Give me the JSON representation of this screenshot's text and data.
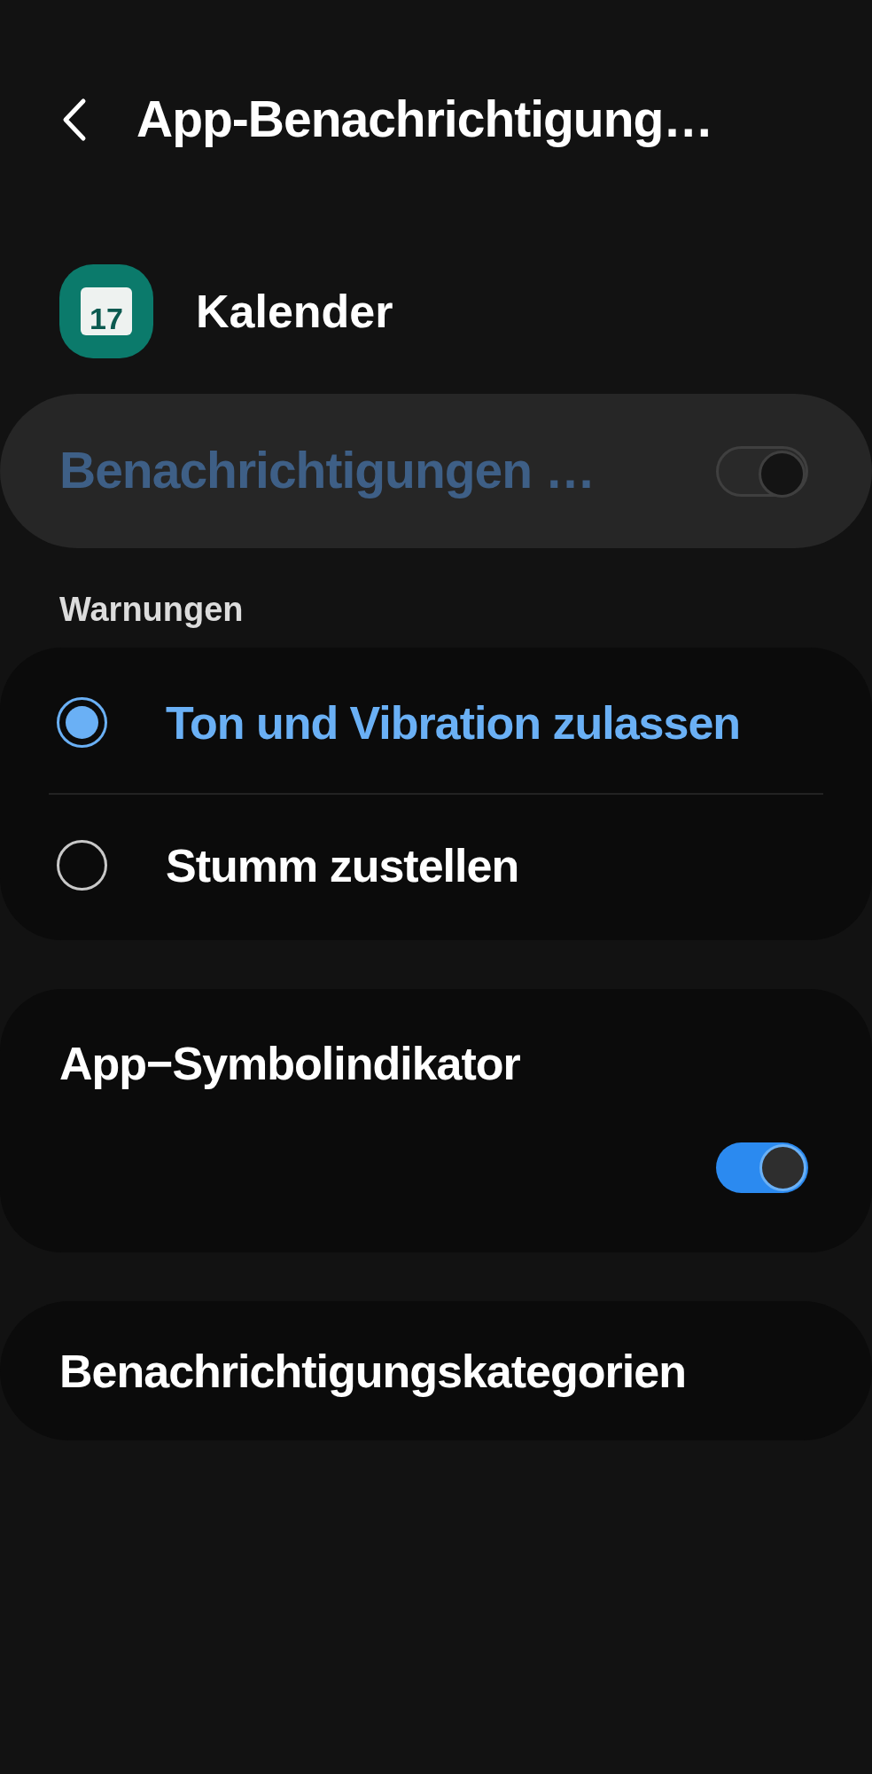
{
  "header": {
    "title": "App-Benachrichtigung…"
  },
  "app": {
    "name": "Kalender",
    "icon_text": "17"
  },
  "master": {
    "label": "Benachrichtigungen …",
    "on": false,
    "disabled": true
  },
  "alerts": {
    "heading": "Warnungen",
    "options": [
      {
        "label": "Ton und Vibration zulassen",
        "selected": true
      },
      {
        "label": "Stumm zustellen",
        "selected": false
      }
    ]
  },
  "badge": {
    "label": "App−Symbolindikator",
    "on": true
  },
  "categories": {
    "label": "Benachrichtigungskategorien"
  }
}
